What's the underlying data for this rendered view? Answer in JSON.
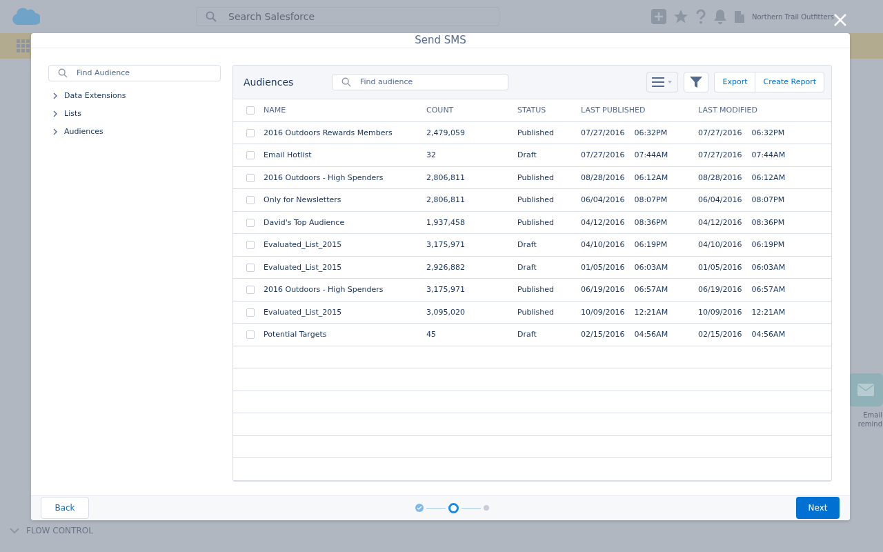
{
  "background": {
    "search": {
      "placeholder": "Search Salesforce"
    },
    "org_name": "Northern Trail Outfitters",
    "left_section": "FLOW CONTROL",
    "right_tile": [
      "Email",
      "remind"
    ]
  },
  "modal": {
    "title": "Send SMS",
    "sidebar": {
      "search": {
        "placeholder": "Find Audience"
      },
      "tree": [
        {
          "label": "Data Extensions",
          "expanded": false
        },
        {
          "label": "Lists",
          "expanded": false
        },
        {
          "label": "Audiences",
          "expanded": false
        }
      ]
    },
    "panel": {
      "title": "Audiences",
      "search": {
        "placeholder": "Find audience"
      },
      "buttons": [
        "Export",
        "Create Report"
      ]
    },
    "table": {
      "columns": [
        "NAME",
        "COUNT",
        "STATUS",
        "LAST PUBLISHED",
        "LAST MODIFIED"
      ],
      "select_all_checked": false,
      "rows": [
        {
          "name": "2016 Outdoors Rewards Members",
          "count": "2,479,059",
          "status": "Published",
          "published": [
            "07/27/2016",
            "06:32PM"
          ],
          "modified": [
            "07/27/2016",
            "06:32PM"
          ],
          "checked": false
        },
        {
          "name": "Email Hotlist",
          "count": "32",
          "status": "Draft",
          "published": [
            "07/27/2016",
            "07:44AM"
          ],
          "modified": [
            "07/27/2016",
            "07:44AM"
          ],
          "checked": false
        },
        {
          "name": "2016 Outdoors - High Spenders",
          "count": "2,806,811",
          "status": "Published",
          "published": [
            "08/28/2016",
            "06:12AM"
          ],
          "modified": [
            "08/28/2016",
            "06:12AM"
          ],
          "checked": false
        },
        {
          "name": "Only for Newsletters",
          "count": "2,806,811",
          "status": "Published",
          "published": [
            "06/04/2016",
            "08:07PM"
          ],
          "modified": [
            "06/04/2016",
            "08:07PM"
          ],
          "checked": false
        },
        {
          "name": "David's Top Audience",
          "count": "1,937,458",
          "status": "Published",
          "published": [
            "04/12/2016",
            "08:36PM"
          ],
          "modified": [
            "04/12/2016",
            "08:36PM"
          ],
          "checked": false
        },
        {
          "name": "Evaluated_List_2015",
          "count": "3,175,971",
          "status": "Draft",
          "published": [
            "04/10/2016",
            "06:19PM"
          ],
          "modified": [
            "04/10/2016",
            "06:19PM"
          ],
          "checked": false
        },
        {
          "name": "Evaluated_List_2015",
          "count": "2,926,882",
          "status": "Draft",
          "published": [
            "01/05/2016",
            "06:03AM"
          ],
          "modified": [
            "01/05/2016",
            "06:03AM"
          ],
          "checked": false
        },
        {
          "name": "2016 Outdoors - High Spenders",
          "count": "3,175,971",
          "status": "Published",
          "published": [
            "06/19/2016",
            "06:57AM"
          ],
          "modified": [
            "06/19/2016",
            "06:57AM"
          ],
          "checked": false
        },
        {
          "name": "Evaluated_List_2015",
          "count": "3,095,020",
          "status": "Published",
          "published": [
            "10/09/2016",
            "12:21AM"
          ],
          "modified": [
            "10/09/2016",
            "12:21AM"
          ],
          "checked": false
        },
        {
          "name": "Potential Targets",
          "count": "45",
          "status": "Draft",
          "published": [
            "02/15/2016",
            "04:56AM"
          ],
          "modified": [
            "02/15/2016",
            "04:56AM"
          ],
          "checked": false
        }
      ]
    },
    "footer": {
      "back": "Back",
      "next": "Next",
      "steps": [
        {
          "completed": true,
          "selected": false
        },
        {
          "completed": false,
          "selected": true
        },
        {
          "completed": false,
          "selected": false
        }
      ]
    }
  }
}
